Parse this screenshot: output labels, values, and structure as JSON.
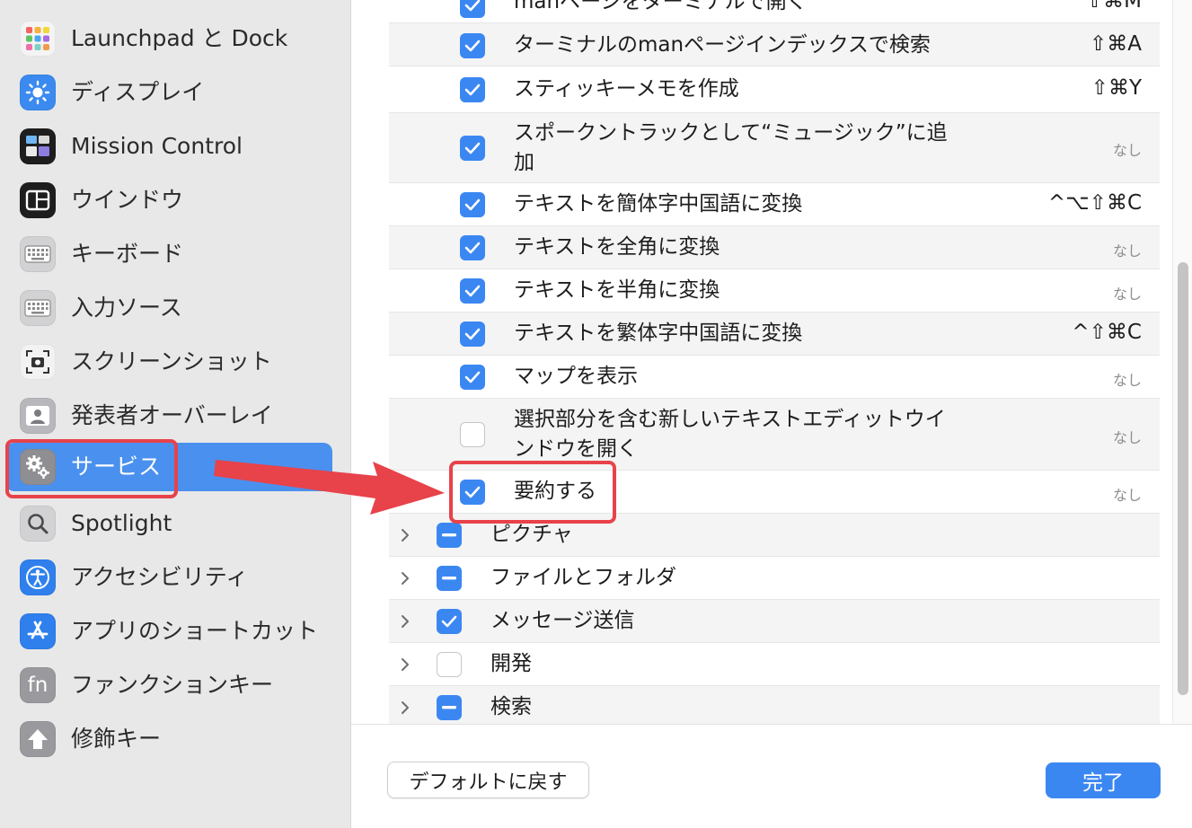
{
  "sidebar": {
    "items": [
      {
        "label": "Launchpad と Dock",
        "icon": "launchpad-dock-icon"
      },
      {
        "label": "ディスプレイ",
        "icon": "display-brightness-icon"
      },
      {
        "label": "Mission Control",
        "icon": "mission-control-icon"
      },
      {
        "label": "ウインドウ",
        "icon": "window-icon"
      },
      {
        "label": "キーボード",
        "icon": "keyboard-icon"
      },
      {
        "label": "入力ソース",
        "icon": "input-source-keyboard-icon"
      },
      {
        "label": "スクリーンショット",
        "icon": "screenshot-camera-icon"
      },
      {
        "label": "発表者オーバーレイ",
        "icon": "presenter-overlay-icon"
      },
      {
        "label": "サービス",
        "icon": "services-gear-icon",
        "selected": true
      },
      {
        "label": "Spotlight",
        "icon": "spotlight-search-icon"
      },
      {
        "label": "アクセシビリティ",
        "icon": "accessibility-icon"
      },
      {
        "label": "アプリのショートカット",
        "icon": "app-shortcuts-icon"
      },
      {
        "label": "ファンクションキー",
        "icon": "function-key-icon",
        "glyph": "fn"
      },
      {
        "label": "修飾キー",
        "icon": "modifier-key-arrow-icon"
      }
    ]
  },
  "services": {
    "rows": [
      {
        "label": "manページをターミナルで開く",
        "shortcut": "⇧⌘M",
        "checked": "on"
      },
      {
        "label": "ターミナルのmanページインデックスで検索",
        "shortcut": "⇧⌘A",
        "checked": "on"
      },
      {
        "label": "スティッキーメモを作成",
        "shortcut": "⇧⌘Y",
        "checked": "on"
      },
      {
        "label": "スポークントラックとして“ミュージック”に追加",
        "shortcut": "なし",
        "checked": "on"
      },
      {
        "label": "テキストを簡体字中国語に変換",
        "shortcut": "^⌥⇧⌘C",
        "checked": "on"
      },
      {
        "label": "テキストを全角に変換",
        "shortcut": "なし",
        "checked": "on"
      },
      {
        "label": "テキストを半角に変換",
        "shortcut": "なし",
        "checked": "on"
      },
      {
        "label": "テキストを繁体字中国語に変換",
        "shortcut": "^⇧⌘C",
        "checked": "on"
      },
      {
        "label": "マップを表示",
        "shortcut": "なし",
        "checked": "on"
      },
      {
        "label": "選択部分を含む新しいテキストエディットウインドウを開く",
        "shortcut": "なし",
        "checked": "off"
      },
      {
        "label": "要約する",
        "shortcut": "なし",
        "checked": "on"
      }
    ],
    "groups": [
      {
        "label": "ピクチャ",
        "checked": "mixed"
      },
      {
        "label": "ファイルとフォルダ",
        "checked": "mixed"
      },
      {
        "label": "メッセージ送信",
        "checked": "on"
      },
      {
        "label": "開発",
        "checked": "off"
      },
      {
        "label": "検索",
        "checked": "mixed"
      }
    ]
  },
  "footer": {
    "restore_defaults_label": "デフォルトに戻す",
    "done_label": "完了"
  },
  "colors": {
    "accent": "#3b87f2",
    "sidebar_selected": "#4a90ee",
    "annotation_red": "#e8424a"
  }
}
